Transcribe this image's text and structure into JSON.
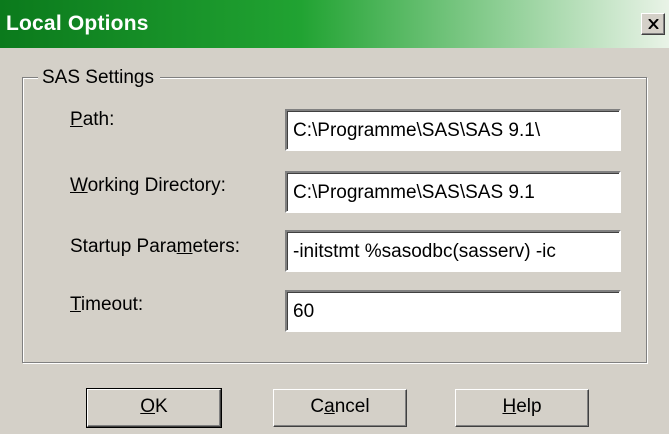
{
  "window": {
    "title": "Local Options"
  },
  "group": {
    "legend": "SAS Settings"
  },
  "fields": [
    {
      "label_pre": "",
      "label_key": "P",
      "label_post": "ath:",
      "value": "C:\\Programme\\SAS\\SAS 9.1\\"
    },
    {
      "label_pre": "",
      "label_key": "W",
      "label_post": "orking Directory:",
      "value": "C:\\Programme\\SAS\\SAS 9.1"
    },
    {
      "label_pre": "Startup Para",
      "label_key": "m",
      "label_post": "eters:",
      "value": "-initstmt %sasodbc(sasserv) -ic"
    },
    {
      "label_pre": "",
      "label_key": "T",
      "label_post": "imeout:",
      "value": "60"
    }
  ],
  "buttons": {
    "ok": {
      "pre": "",
      "key": "O",
      "post": "K"
    },
    "cancel": {
      "pre": "C",
      "key": "a",
      "post": "ncel"
    },
    "help": {
      "pre": "",
      "key": "H",
      "post": "elp"
    }
  },
  "icons": {
    "close": "close-icon"
  }
}
